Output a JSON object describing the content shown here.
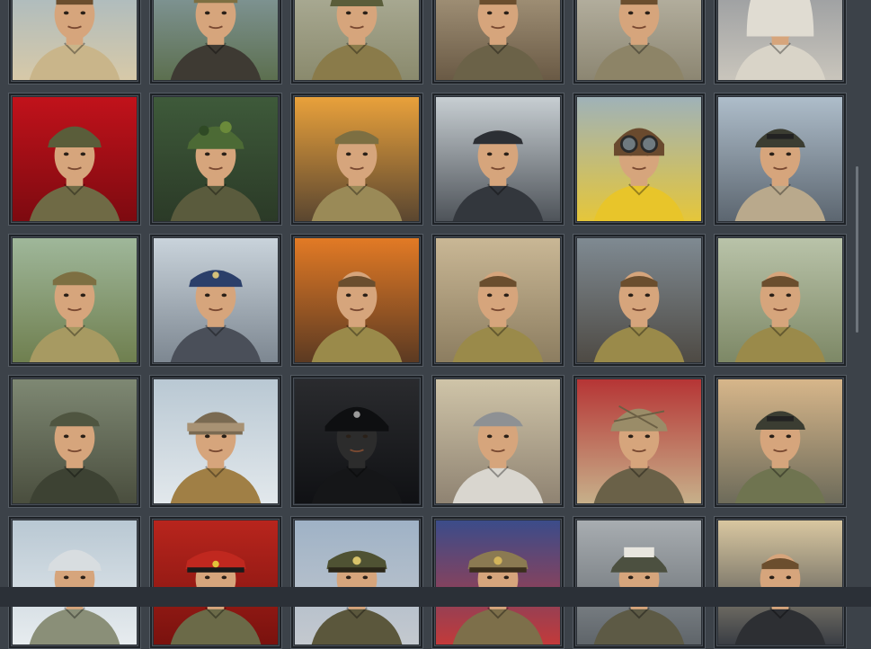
{
  "gallery": {
    "title": "",
    "tiles": [
      {
        "name": "portrait-desert-sniper",
        "theme": "desert",
        "colors": [
          "#9bb6c9",
          "#d7c9a8"
        ],
        "helmet": "none",
        "uniform": "#c9b58a"
      },
      {
        "name": "portrait-tank-commander-flag",
        "theme": "forest",
        "colors": [
          "#8fa5b4",
          "#5c6f4f"
        ],
        "helmet": "cap",
        "uniform": "#3e3a33"
      },
      {
        "name": "portrait-soviet-infantry",
        "theme": "village",
        "colors": [
          "#b7b8a4",
          "#8a8a6d"
        ],
        "helmet": "helmet-green",
        "uniform": "#8a7b4a"
      },
      {
        "name": "portrait-smg-soldier",
        "theme": "ruins",
        "colors": [
          "#b9a98d",
          "#6a5a45"
        ],
        "helmet": "none",
        "uniform": "#6b6248"
      },
      {
        "name": "portrait-mg-gunner",
        "theme": "field",
        "colors": [
          "#c6c2b3",
          "#8c8672"
        ],
        "helmet": "none",
        "uniform": "#8d8467"
      },
      {
        "name": "portrait-winter-hooded",
        "theme": "snow",
        "colors": [
          "#8a8f96",
          "#c9c5bc"
        ],
        "helmet": "hood",
        "uniform": "#d9d4c8"
      },
      {
        "name": "portrait-american-gi",
        "theme": "red",
        "colors": [
          "#c1121b",
          "#7d0a10"
        ],
        "helmet": "helmet-green",
        "uniform": "#6f6a45"
      },
      {
        "name": "portrait-camo-soldier",
        "theme": "jungle",
        "colors": [
          "#3e5a3a",
          "#2b3a27"
        ],
        "helmet": "helmet-camo",
        "uniform": "#5a5b3d"
      },
      {
        "name": "portrait-radio-operator",
        "theme": "explosion",
        "colors": [
          "#e9a13b",
          "#5a4630"
        ],
        "helmet": "cap",
        "uniform": "#9a8a57"
      },
      {
        "name": "portrait-partisan",
        "theme": "birch",
        "colors": [
          "#c7ced2",
          "#4e5359"
        ],
        "helmet": "cap-dark",
        "uniform": "#33373d"
      },
      {
        "name": "portrait-pilot",
        "theme": "sky",
        "colors": [
          "#9fb2b8",
          "#e5c63a"
        ],
        "helmet": "flight",
        "uniform": "#e8c52a"
      },
      {
        "name": "portrait-tank-gunner",
        "theme": "cloud",
        "colors": [
          "#aebdca",
          "#5c6670"
        ],
        "helmet": "tank",
        "uniform": "#b9a98c"
      },
      {
        "name": "portrait-two-soldiers",
        "theme": "forest-light",
        "colors": [
          "#9fb79a",
          "#6f7f4f"
        ],
        "helmet": "cap",
        "uniform": "#a79a62"
      },
      {
        "name": "portrait-fighter-pilot",
        "theme": "plane",
        "colors": [
          "#c9d3db",
          "#7d8791"
        ],
        "helmet": "cap-blue",
        "uniform": "#4a4f59"
      },
      {
        "name": "portrait-soldier-fire",
        "theme": "fire",
        "colors": [
          "#e27a25",
          "#5c3a22"
        ],
        "helmet": "none",
        "uniform": "#9a8a4a"
      },
      {
        "name": "portrait-soldier-sand",
        "theme": "sand",
        "colors": [
          "#c9b795",
          "#8c7d60"
        ],
        "helmet": "none",
        "uniform": "#9a8a4a"
      },
      {
        "name": "portrait-soldier-dusk",
        "theme": "dusk",
        "colors": [
          "#7f8a92",
          "#4e4a44"
        ],
        "helmet": "none",
        "uniform": "#9a8a4a"
      },
      {
        "name": "portrait-soldier-tower",
        "theme": "field-light",
        "colors": [
          "#b9c3a9",
          "#7d8866"
        ],
        "helmet": "none",
        "uniform": "#9a8a4a"
      },
      {
        "name": "portrait-forest-officer",
        "theme": "leaves",
        "colors": [
          "#7e8873",
          "#4a4e3e"
        ],
        "helmet": "cap-field",
        "uniform": "#3d4233"
      },
      {
        "name": "portrait-winter-gunner",
        "theme": "winter",
        "colors": [
          "#b9c8d3",
          "#e2e8ec"
        ],
        "helmet": "ushanka",
        "uniform": "#a07f45"
      },
      {
        "name": "portrait-panzer-crew",
        "theme": "dark",
        "colors": [
          "#2a2b2e",
          "#101114"
        ],
        "helmet": "beret-black",
        "uniform": "#151618"
      },
      {
        "name": "portrait-mountain-rifleman",
        "theme": "mountain",
        "colors": [
          "#cfc4a8",
          "#8f8372"
        ],
        "helmet": "cap-grey",
        "uniform": "#d9d6cf"
      },
      {
        "name": "portrait-camo-netting",
        "theme": "red-sky",
        "colors": [
          "#b63535",
          "#c7b08a"
        ],
        "helmet": "helmet-net",
        "uniform": "#6a6148"
      },
      {
        "name": "portrait-tank-rider",
        "theme": "sunset",
        "colors": [
          "#d7b68a",
          "#6d6b5a"
        ],
        "helmet": "tank",
        "uniform": "#6f7450"
      },
      {
        "name": "portrait-mg42-winter",
        "theme": "snow",
        "colors": [
          "#b9c8d3",
          "#e7ecef"
        ],
        "helmet": "helmet-white",
        "uniform": "#8a8f78"
      },
      {
        "name": "portrait-soviet-officer",
        "theme": "flag-red",
        "colors": [
          "#b8251d",
          "#7a120e"
        ],
        "helmet": "cap-red",
        "uniform": "#6b6a48"
      },
      {
        "name": "portrait-us-officer",
        "theme": "flag-us",
        "colors": [
          "#9fb2c6",
          "#c4c9cf"
        ],
        "helmet": "cap-olive",
        "uniform": "#5b573c"
      },
      {
        "name": "portrait-british-officer",
        "theme": "flag-uk",
        "colors": [
          "#3b4c8a",
          "#c23a3a"
        ],
        "helmet": "cap-khaki",
        "uniform": "#7d6f4a"
      },
      {
        "name": "portrait-born-to-build",
        "theme": "smoke",
        "colors": [
          "#a8adb1",
          "#5f656a"
        ],
        "helmet": "helmet-text",
        "uniform": "#5d5a45"
      },
      {
        "name": "portrait-civilian-officer",
        "theme": "office",
        "colors": [
          "#d9c7a0",
          "#3a3e44"
        ],
        "helmet": "none",
        "uniform": "#2d2f33"
      }
    ]
  }
}
